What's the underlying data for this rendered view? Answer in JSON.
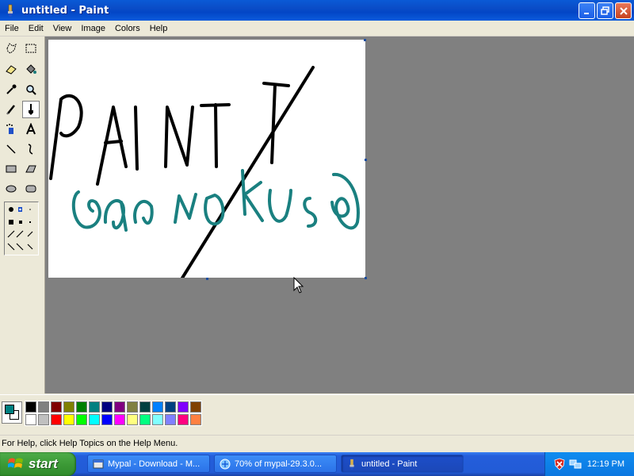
{
  "window": {
    "title": "untitled - Paint",
    "icon": "paint-icon",
    "controls": [
      "minimize",
      "maximize",
      "close"
    ]
  },
  "menu": [
    "File",
    "Edit",
    "View",
    "Image",
    "Colors",
    "Help"
  ],
  "toolbox": {
    "tools": [
      "free-form-select",
      "select",
      "eraser",
      "fill-with-color",
      "pick-color",
      "magnifier",
      "pencil",
      "brush",
      "airbrush",
      "text",
      "line",
      "curve",
      "rectangle",
      "polygon",
      "ellipse",
      "rounded-rectangle"
    ],
    "selected": "brush"
  },
  "canvas": {
    "drawing": {
      "text_black": "PAINT",
      "text_teal": "Ganonous",
      "ink_black": "#000000",
      "ink_teal": "#1a8080"
    }
  },
  "palette": {
    "foreground": "#008080",
    "background": "#ffffff",
    "row1": [
      "#000000",
      "#808080",
      "#800000",
      "#808000",
      "#008000",
      "#008080",
      "#000080",
      "#800080",
      "#808040",
      "#004040",
      "#0080ff",
      "#004080",
      "#8000ff",
      "#804000"
    ],
    "row2": [
      "#ffffff",
      "#c0c0c0",
      "#ff0000",
      "#ffff00",
      "#00ff00",
      "#00ffff",
      "#0000ff",
      "#ff00ff",
      "#ffff80",
      "#00ff80",
      "#80ffff",
      "#8080ff",
      "#ff0080",
      "#ff8040"
    ]
  },
  "statusbar": {
    "help_text": "For Help, click Help Topics on the Help Menu."
  },
  "taskbar": {
    "start_label": "start",
    "tasks": [
      {
        "label": "Mypal - Download - M...",
        "icon": "mypal-icon"
      },
      {
        "label": "70% of mypal-29.3.0...",
        "icon": "download-icon"
      },
      {
        "label": "untitled - Paint",
        "icon": "paint-icon",
        "active": true
      }
    ],
    "tray_icons": [
      "security-alert-icon",
      "network-icon"
    ],
    "clock": "12:19 PM"
  }
}
